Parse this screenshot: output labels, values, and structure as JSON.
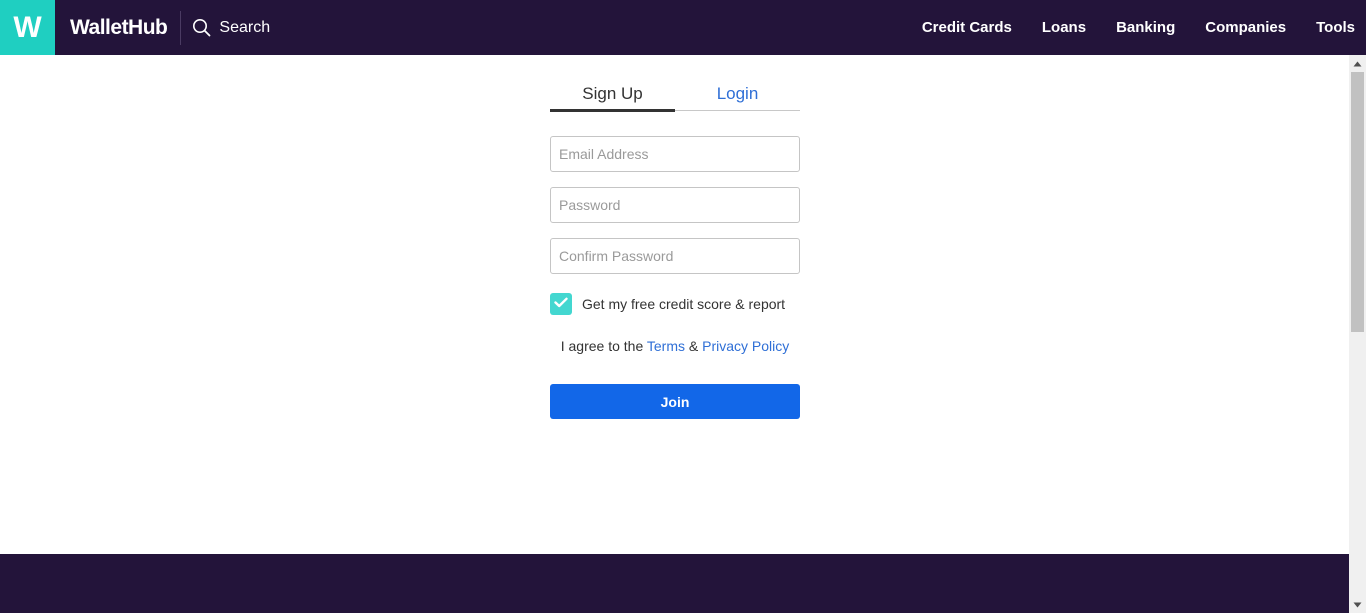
{
  "header": {
    "logo_letter": "W",
    "brand": "WalletHub",
    "search_label": "Search",
    "nav": [
      {
        "label": "Credit Cards"
      },
      {
        "label": "Loans"
      },
      {
        "label": "Banking"
      },
      {
        "label": "Companies"
      },
      {
        "label": "Tools"
      }
    ]
  },
  "form": {
    "tabs": [
      {
        "label": "Sign Up",
        "active": true
      },
      {
        "label": "Login",
        "active": false
      }
    ],
    "fields": {
      "email_placeholder": "Email Address",
      "password_placeholder": "Password",
      "confirm_placeholder": "Confirm Password"
    },
    "checkbox": {
      "label": "Get my free credit score & report",
      "checked": true
    },
    "agree": {
      "prefix": "I agree to the ",
      "terms": "Terms",
      "amp": " & ",
      "privacy": "Privacy Policy"
    },
    "join_label": "Join"
  },
  "colors": {
    "header_bg": "#23143a",
    "logo_bg": "#1fcfc1",
    "link": "#2f6fd6",
    "join_bg": "#1267e8",
    "checkbox_bg": "#43d7d0"
  },
  "icons": {
    "search": "search-icon",
    "check": "checkmark-icon",
    "scroll_up": "arrow-up-icon",
    "scroll_down": "arrow-down-icon"
  }
}
